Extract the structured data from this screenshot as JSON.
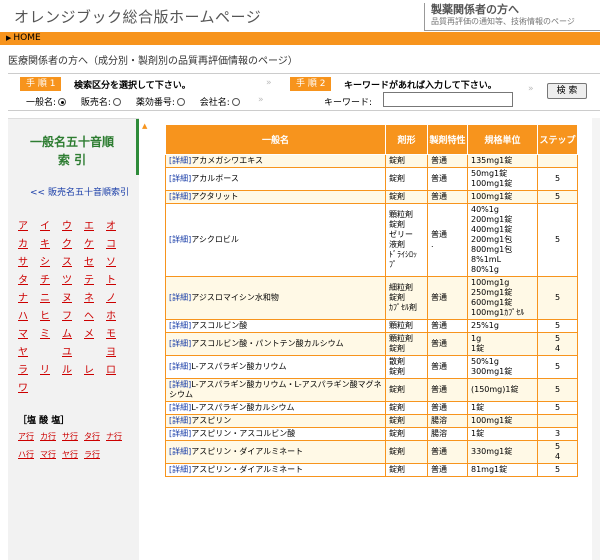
{
  "header": {
    "site_title": "オレンジブック総合版ホームページ",
    "corner_title": "製薬関係者の方へ",
    "corner_sub": "品質再評価の通知等、技術情報のページ"
  },
  "homebar": {
    "arrow": "▶",
    "label": "HOME"
  },
  "page_subtitle": "医療関係者の方へ（成分別・製剤別の品質再評価情報のページ）",
  "search": {
    "step1_label": "手 順 1",
    "step1_text": "検索区分を選択して下さい。",
    "step2_label": "手 順 2",
    "step2_text": "キーワードがあれば入力して下さい。",
    "chevron": "»",
    "options": [
      {
        "label": "一般名:",
        "checked": true
      },
      {
        "label": "販売名:",
        "checked": false
      },
      {
        "label": "薬効番号:",
        "checked": false
      },
      {
        "label": "会社名:",
        "checked": false
      }
    ],
    "keyword_label": "キーワード:",
    "keyword_value": "",
    "button_label": "検 索"
  },
  "sidebar": {
    "title_line1": "一般名五十音順",
    "title_line2": "索 引",
    "link_label": "<< 販売名五十音順索引",
    "kana_rows": [
      [
        "ア",
        "イ",
        "ウ",
        "エ",
        "オ"
      ],
      [
        "カ",
        "キ",
        "ク",
        "ケ",
        "コ"
      ],
      [
        "サ",
        "シ",
        "ス",
        "セ",
        "ソ"
      ],
      [
        "タ",
        "チ",
        "ツ",
        "テ",
        "ト"
      ],
      [
        "ナ",
        "ニ",
        "ヌ",
        "ネ",
        "ノ"
      ],
      [
        "ハ",
        "ヒ",
        "フ",
        "ヘ",
        "ホ"
      ],
      [
        "マ",
        "ミ",
        "ム",
        "メ",
        "モ"
      ],
      [
        "ヤ",
        "",
        "ユ",
        "",
        "ヨ"
      ],
      [
        "ラ",
        "リ",
        "ル",
        "レ",
        "ロ"
      ],
      [
        "ワ",
        "",
        "",
        "",
        ""
      ]
    ],
    "salt_heading": "［塩 酸 塩］",
    "salt_rows": [
      [
        "ア行",
        "カ行",
        "サ行",
        "タ行",
        "ナ行"
      ],
      [
        "ハ行",
        "マ行",
        "ヤ行",
        "ラ行"
      ]
    ],
    "scroll_indicator": "▲"
  },
  "table": {
    "headers": [
      "一般名",
      "剤形",
      "製剤特性",
      "規格単位",
      "ステップ"
    ],
    "detail_label": "[詳細]",
    "rows": [
      {
        "name": "アカメガシワエキス",
        "form": "錠剤",
        "feature": "普通",
        "spec": "135mg1錠",
        "step": ""
      },
      {
        "name": "アカルボース",
        "form": "錠剤",
        "feature": "普通",
        "spec": "50mg1錠\n100mg1錠",
        "step": "5"
      },
      {
        "name": "アクタリット",
        "form": "錠剤",
        "feature": "普通",
        "spec": "100mg1錠",
        "step": "5"
      },
      {
        "name": "アシクロビル",
        "form": "顆粒剤\n錠剤\nゼリー\n液剤\nﾄﾞﾗｲｼﾛｯﾌﾟ",
        "feature": "普通\n.",
        "spec": "40%1g\n200mg1錠\n400mg1錠\n200mg1包\n800mg1包\n8%1mL\n80%1g",
        "step": "5"
      },
      {
        "name": "アジスロマイシン水和物",
        "form": "細粒剤\n錠剤\nｶﾌﾟｾﾙ剤",
        "feature": "普通",
        "spec": "100mg1g\n250mg1錠\n600mg1錠\n100mg1ｶﾌﾟｾﾙ",
        "step": "5"
      },
      {
        "name": "アスコルビン酸",
        "form": "顆粒剤",
        "feature": "普通",
        "spec": "25%1g",
        "step": "5"
      },
      {
        "name": "アスコルビン酸・パントテン酸カルシウム",
        "form": "顆粒剤\n錠剤",
        "feature": "普通",
        "spec": "1g\n1錠",
        "step": "5\n4"
      },
      {
        "name": "L-アスパラギン酸カリウム",
        "form": "散剤\n錠剤",
        "feature": "普通",
        "spec": "50%1g\n300mg1錠",
        "step": "5"
      },
      {
        "name": "L-アスパラギン酸カリウム・L-アスパラギン酸マグネシウム",
        "form": "錠剤",
        "feature": "普通",
        "spec": "(150mg)1錠",
        "step": "5"
      },
      {
        "name": "L-アスパラギン酸カルシウム",
        "form": "錠剤",
        "feature": "普通",
        "spec": "1錠",
        "step": "5"
      },
      {
        "name": "アスピリン",
        "form": "錠剤",
        "feature": "腸溶",
        "spec": "100mg1錠",
        "step": ""
      },
      {
        "name": "アスピリン・アスコルビン酸",
        "form": "錠剤",
        "feature": "腸溶",
        "spec": "1錠",
        "step": "3"
      },
      {
        "name": "アスピリン・ダイアルミネート",
        "form": "錠剤",
        "feature": "普通",
        "spec": "330mg1錠",
        "step": "5\n4"
      },
      {
        "name": "アスピリン・ダイアルミネート",
        "form": "錠剤",
        "feature": "普通",
        "spec": "81mg1錠",
        "step": "5"
      }
    ]
  }
}
